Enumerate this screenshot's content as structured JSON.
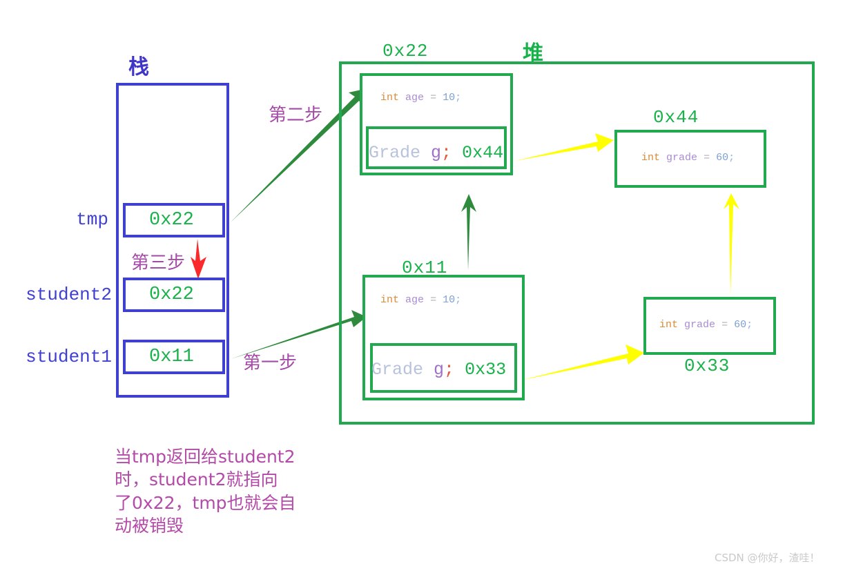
{
  "stack": {
    "title": "栈",
    "slots": [
      {
        "label": "tmp",
        "value": "0x22"
      },
      {
        "label": "student2",
        "value": "0x22"
      },
      {
        "label": "student1",
        "value": "0x11"
      }
    ]
  },
  "heap": {
    "title": "堆",
    "objects": [
      {
        "address": "0x22",
        "lines": [
          {
            "type": "int",
            "ident": "age",
            "op": "=",
            "num": "10",
            "semi": ";"
          }
        ],
        "field": {
          "class": "Grade",
          "var": "g",
          "semi": ";",
          "addr": "0x44"
        }
      },
      {
        "address": "0x11",
        "lines": [
          {
            "type": "int",
            "ident": "age",
            "op": "=",
            "num": "10",
            "semi": ";"
          }
        ],
        "field": {
          "class": "Grade",
          "var": "g",
          "semi": ";",
          "addr": "0x33"
        }
      },
      {
        "address": "0x44",
        "lines": [
          {
            "type": "int",
            "ident": "grade",
            "op": "=",
            "num": "60",
            "semi": ";"
          }
        ]
      },
      {
        "address": "0x33",
        "lines": [
          {
            "type": "int",
            "ident": "grade",
            "op": "=",
            "num": "60",
            "semi": ";"
          }
        ]
      }
    ]
  },
  "steps": {
    "step1": "第一步",
    "step2": "第二步",
    "step3": "第三步"
  },
  "note": "当tmp返回给student2\n时，student2就指向\n了0x22，tmp也就会自\n动被销毁",
  "watermark": "CSDN @你好，渣哇！",
  "colors": {
    "stack_blue": "#4040d0",
    "heap_green": "#22a84e",
    "addr_green": "#19b24a",
    "arrow_green": "#2e8b3d",
    "arrow_yellow": "#ffff00",
    "arrow_red": "#fa2a2a",
    "step_purple": "#a54aa8",
    "note_purple": "#b44aa8",
    "watermark_gray": "#c9c9c9"
  }
}
